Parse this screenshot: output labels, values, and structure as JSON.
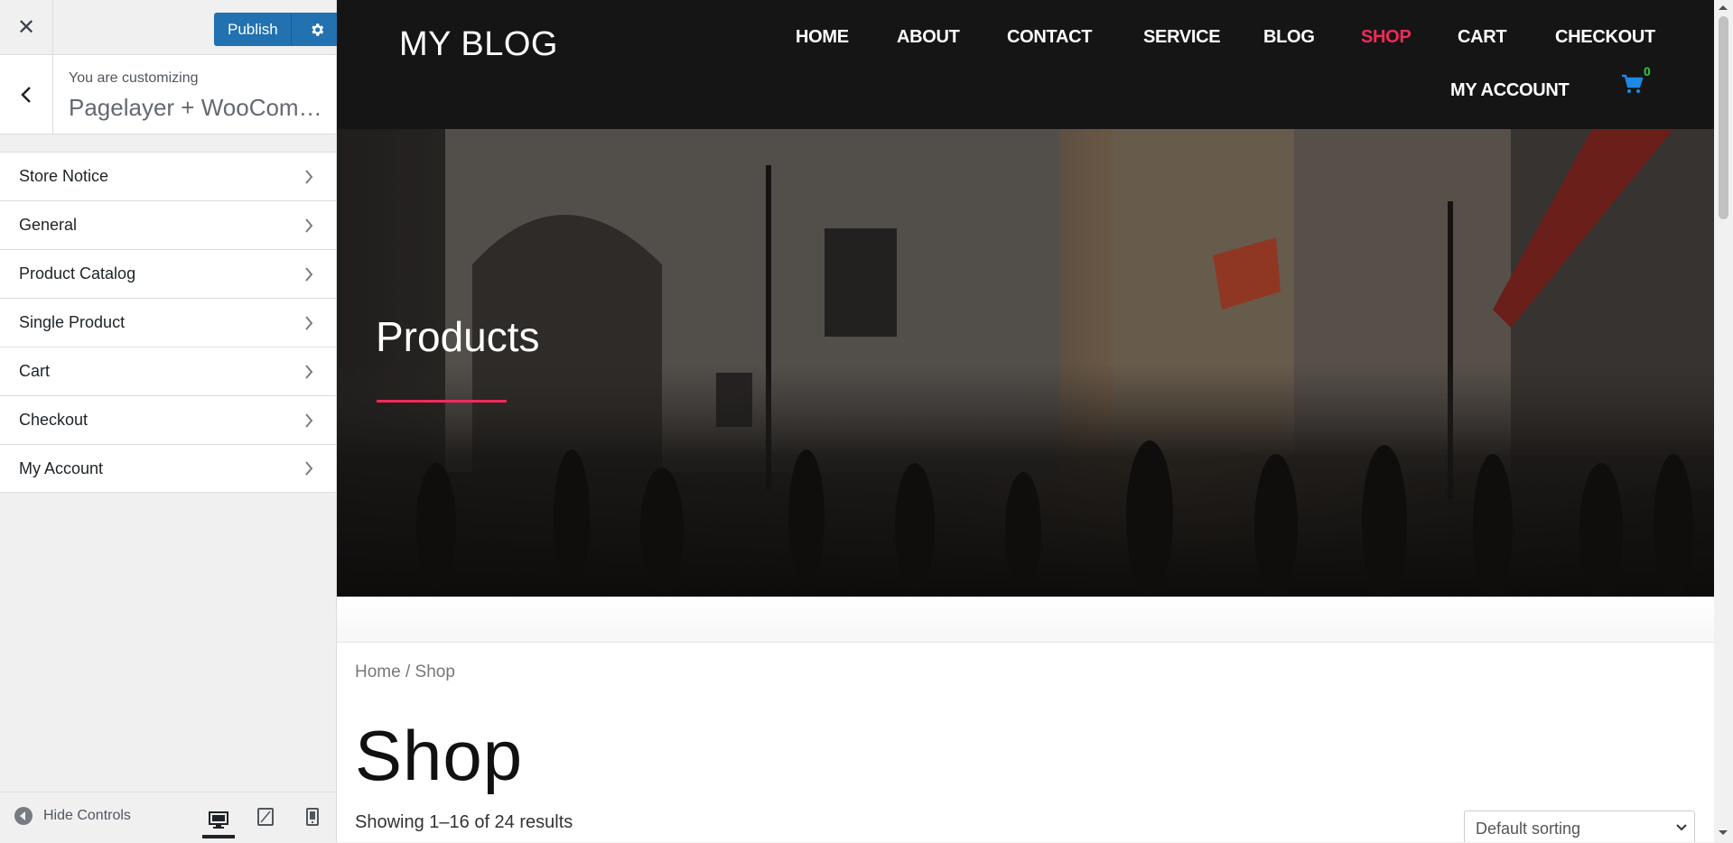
{
  "sidebar": {
    "close_icon": "close-icon",
    "publish_label": "Publish",
    "customizing_label": "You are customizing",
    "site_name": "Pagelayer + WooCommerce",
    "sections": [
      {
        "label": "Store Notice"
      },
      {
        "label": "General"
      },
      {
        "label": "Product Catalog"
      },
      {
        "label": "Single Product"
      },
      {
        "label": "Cart"
      },
      {
        "label": "Checkout"
      },
      {
        "label": "My Account"
      }
    ],
    "hide_controls_label": "Hide Controls",
    "devices": [
      "desktop",
      "tablet",
      "mobile"
    ],
    "active_device": "desktop"
  },
  "preview": {
    "logo": "MY BLOG",
    "nav": [
      {
        "label": "HOME"
      },
      {
        "label": "ABOUT"
      },
      {
        "label": "CONTACT"
      },
      {
        "label": "SERVICE"
      },
      {
        "label": "BLOG"
      },
      {
        "label": "SHOP",
        "active": true
      },
      {
        "label": "CART"
      },
      {
        "label": "CHECKOUT"
      },
      {
        "label": "MY ACCOUNT"
      }
    ],
    "cart_count": "0",
    "hero_title": "Products",
    "breadcrumb": "Home / Shop",
    "page_title": "Shop",
    "results_text": "Showing 1–16 of 24 results",
    "sorting_selected": "Default sorting"
  },
  "colors": {
    "accent": "#f2295b",
    "publish": "#2271b1",
    "header_bg": "#151515",
    "cart_icon": "#1e88e5",
    "cart_badge": "#2ecc40"
  }
}
